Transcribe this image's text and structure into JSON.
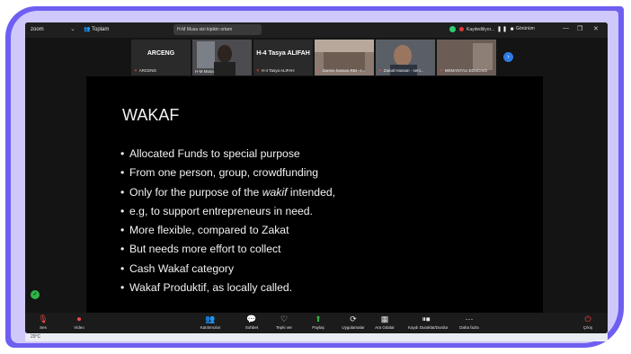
{
  "titlebar": {
    "app_name": "zoom",
    "participants_label": "Toplam",
    "meeting_label": "H-M Musa sizi kipikin ortam",
    "recording_label": "Kaydediliyor...",
    "view_label": "Görünüm"
  },
  "participants": [
    {
      "big_name": "ARCENG",
      "name": "ARCENG"
    },
    {
      "big_name": "",
      "name": "H-M Musa"
    },
    {
      "big_name": "H-4 Tasya ALIFAH",
      "name": "H-4 Tasya ALIFAH"
    },
    {
      "big_name": "",
      "name": "Zarmis hassan RBI - I..."
    },
    {
      "big_name": "",
      "name": "Zainal Hassan - seni..."
    },
    {
      "big_name": "",
      "name": "MEMANTAU EDUCAIO"
    }
  ],
  "slide": {
    "title": "WAKAF",
    "bullets": [
      {
        "before": "Allocated Funds to special purpose",
        "em": "",
        "after": ""
      },
      {
        "before": "From one person, group, crowdfunding",
        "em": "",
        "after": ""
      },
      {
        "before": "Only for the purpose of the ",
        "em": "wakif",
        "after": " intended,"
      },
      {
        "before": "e.g, to support entrepreneurs in need.",
        "em": "",
        "after": ""
      },
      {
        "before": "More flexible, compared to Zakat",
        "em": "",
        "after": ""
      },
      {
        "before": "But needs more effort to collect",
        "em": "",
        "after": ""
      },
      {
        "before": "Cash Wakaf category",
        "em": "",
        "after": ""
      },
      {
        "before": "Wakaf Produktif, as locally called.",
        "em": "",
        "after": ""
      }
    ],
    "bullet_char": "•"
  },
  "toolbar": {
    "audio": "Ses",
    "video": "Video",
    "participants": "Katılımcılar",
    "chat": "Sohbet",
    "react": "Tepki ver",
    "share": "Paylaş",
    "apps": "Uygulamalar",
    "view": "Ara Odalar",
    "record": "Kaydı Duraklat/Durdur",
    "more": "Daha fazla",
    "leave": "Çıkış"
  },
  "taskbar": {
    "weather": "29°C"
  },
  "colors": {
    "frame_purple": "#6e5ff0",
    "frame_lavender": "#cfc8fb",
    "active_speaker": "#37c24a",
    "record_red": "#e53935"
  },
  "icons": [
    "microphone-muted-icon",
    "video-off-icon",
    "participants-icon",
    "chat-icon",
    "heart-icon",
    "share-screen-icon",
    "apps-icon",
    "breakout-rooms-icon",
    "record-pause-icon",
    "more-icon",
    "shield-icon"
  ]
}
